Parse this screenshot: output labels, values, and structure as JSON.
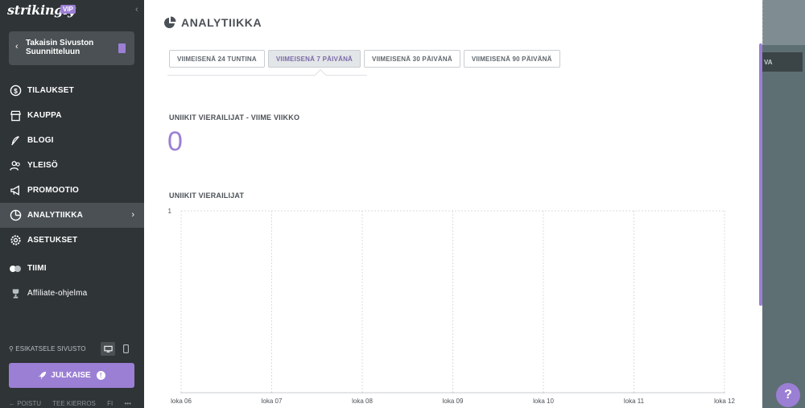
{
  "brand": {
    "logo": "strikingly",
    "badge": "VIP"
  },
  "sidebar": {
    "back_button": "Takaisin Sivuston Suunnitteluun",
    "items": [
      {
        "label": "TILAUKSET",
        "icon": "dollar-circle-icon"
      },
      {
        "label": "KAUPPA",
        "icon": "store-icon"
      },
      {
        "label": "BLOGI",
        "icon": "quill-icon"
      },
      {
        "label": "YLEISÖ",
        "icon": "people-icon"
      },
      {
        "label": "PROMOOTIO",
        "icon": "megaphone-icon"
      },
      {
        "label": "ANALYTIIKKA",
        "icon": "pie-chart-icon",
        "active": true
      },
      {
        "label": "ASETUKSET",
        "icon": "gear-icon"
      },
      {
        "label": "TIIMI",
        "icon": "team-icon"
      },
      {
        "label": "Affiliate-ohjelma",
        "icon": "trophy-icon"
      }
    ],
    "preview_label": "ESIKATSELE SIVUSTO",
    "publish_label": "JULKAISE",
    "publish_warning": "!",
    "bottom_links": [
      "← POISTU",
      "TEE KIERROS",
      "FI",
      "•••"
    ]
  },
  "main": {
    "title": "ANALYTIIKKA",
    "tabs": [
      "VIIMEISENÄ 24 TUNTINA",
      "VIIMEISENÄ 7 PÄIVÄNÄ",
      "VIIMEISENÄ 30 PÄIVÄNÄ",
      "VIIMEISENÄ 90 PÄIVÄNÄ"
    ],
    "active_tab": 1,
    "unique_week_label": "UNIIKIT VIERAILIJAT - VIIME VIIKKO",
    "unique_week_value": "0",
    "chart_section_label": "UNIIKIT VIERAILIJAT"
  },
  "right_panel": {
    "button_text": "VA",
    "help": "?"
  },
  "colors": {
    "accent": "#9b7fd4",
    "sidebar": "#2f3437",
    "sidebar_active": "#4a5054"
  },
  "chart_data": {
    "type": "line",
    "x": [
      "loka 06",
      "loka 07",
      "loka 08",
      "loka 09",
      "loka 10",
      "loka 11",
      "loka 12"
    ],
    "series": [
      {
        "values": [
          0,
          0,
          0,
          0,
          0,
          0,
          0
        ]
      }
    ],
    "ylim": [
      0,
      1
    ],
    "yticks": [
      "1"
    ],
    "grid": true
  }
}
